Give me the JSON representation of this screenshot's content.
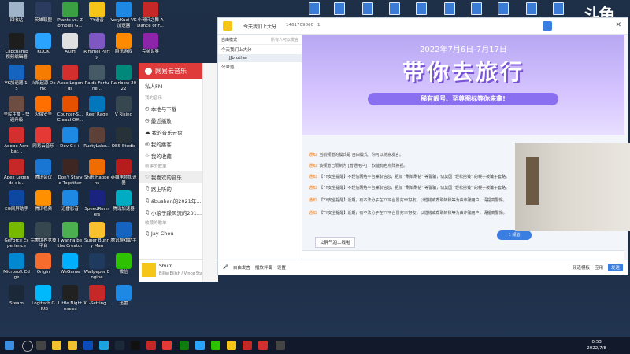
{
  "desktop_icons": [
    {
      "label": "回收站",
      "color": "#9fb4c9"
    },
    {
      "label": "英雄联盟",
      "color": "#2b3b5f"
    },
    {
      "label": "Plants vs. Zombies G...",
      "color": "#3aa043"
    },
    {
      "label": "YY语音",
      "color": "#f5c518"
    },
    {
      "label": "VeryKuai VK 加速器",
      "color": "#1e88e5"
    },
    {
      "label": "小哥只之舞 A Dance of F...",
      "color": "#c62828"
    },
    {
      "label": "Clipchamp 视频编辑器",
      "color": "#1d1d1d"
    },
    {
      "label": "KOOK",
      "color": "#2aa3ff"
    },
    {
      "label": "ALTH",
      "color": "#e0e0e0"
    },
    {
      "label": "Rimmel Party",
      "color": "#7e57c2"
    },
    {
      "label": "腾讯游戏",
      "color": "#ff8a00"
    },
    {
      "label": "完美世界",
      "color": "#8e24aa"
    },
    {
      "label": "VK加速器 1.5",
      "color": "#1565c0"
    },
    {
      "label": "火焰起源 Demo",
      "color": "#f57c00"
    },
    {
      "label": "Apex Legends",
      "color": "#d32f2f"
    },
    {
      "label": "Raids Fortune...",
      "color": "#455a64"
    },
    {
      "label": "Rainbow 2022",
      "color": "#00897b"
    },
    {
      "label": "全民主播 - 快速升级",
      "color": "#6d4c41"
    },
    {
      "label": "火绒安全",
      "color": "#ff6f00"
    },
    {
      "label": "Counter-S... Global Off...",
      "color": "#e65100"
    },
    {
      "label": "Reef Rage",
      "color": "#0277bd"
    },
    {
      "label": "V Rising",
      "color": "#37474f"
    },
    {
      "label": "Adobe Acrobat...",
      "color": "#d32f2f"
    },
    {
      "label": "网易云音乐",
      "color": "#e53935"
    },
    {
      "label": "Dev-C++",
      "color": "#1e88e5"
    },
    {
      "label": "RustyLake...",
      "color": "#5d4037"
    },
    {
      "label": "OBS Studio",
      "color": "#263238"
    },
    {
      "label": "Apex Legends dir...",
      "color": "#c62828"
    },
    {
      "label": "腾讯会议",
      "color": "#1976d2"
    },
    {
      "label": "Don't Starve Together",
      "color": "#3e2723"
    },
    {
      "label": "Shift Happens",
      "color": "#ef6c00"
    },
    {
      "label": "英雄电竞加速器",
      "color": "#b71c1c"
    },
    {
      "label": "EG同屏助手",
      "color": "#0d47a1"
    },
    {
      "label": "腾讯视频",
      "color": "#ff9100"
    },
    {
      "label": "迅雷影音",
      "color": "#1e88e5"
    },
    {
      "label": "SpeedRunners",
      "color": "#1a237e"
    },
    {
      "label": "腾讯加速器",
      "color": "#00acc1"
    },
    {
      "label": "GeForce Experience",
      "color": "#76b900"
    },
    {
      "label": "完美世界竞技平台",
      "color": "#37474f"
    },
    {
      "label": "I wanna be the Creator",
      "color": "#4caf50"
    },
    {
      "label": "Super Bunny Man",
      "color": "#fbc02d"
    },
    {
      "label": "腾讯游戏助手",
      "color": "#1565c0"
    },
    {
      "label": "Microsoft Edge",
      "color": "#0288d1"
    },
    {
      "label": "Origin",
      "color": "#f56c2d"
    },
    {
      "label": "WeGame",
      "color": "#00b0ff"
    },
    {
      "label": "Wallpaper Engine",
      "color": "#1e3a5f"
    },
    {
      "label": "微信",
      "color": "#2dc100"
    },
    {
      "label": "Steam",
      "color": "#1b2838"
    },
    {
      "label": "Logitech G HUB",
      "color": "#00b8fc"
    },
    {
      "label": "Little Nightmares",
      "color": "#212121"
    },
    {
      "label": "XL-Setting...",
      "color": "#c62828"
    },
    {
      "label": "迅雷",
      "color": "#1e88e5"
    }
  ],
  "netease": {
    "app_name": "网易云音乐",
    "private_fm": "私人FM",
    "my_music_section": "我的音乐",
    "my_items": [
      "本地与下载",
      "最近播放",
      "我的音乐云盘",
      "我的播客",
      "我的收藏"
    ],
    "created_section": "创建的歌单",
    "playlists": [
      "我喜欢的音乐",
      "路上听的",
      "ábushan的2021年...",
      "小狼子躁风流的201...",
      "Jay Chou"
    ],
    "collected_section": "收藏的歌单",
    "now_playing": {
      "title": "Sburn",
      "artist": "Billie Eilish / Vince Staples"
    }
  },
  "yy": {
    "channel_title": "今天我们上大分",
    "channel_id": "1461709860",
    "channel_count": "1",
    "left_tab_active": "自由模式",
    "left_tab_2": "所有人可以发言",
    "channel_tree": [
      "今天我们上大分",
      "JJbrother",
      "公众氪"
    ],
    "banner_date": "2022年7月6日-7月17日",
    "banner_title": "带你去旅行",
    "banner_subtitle": "稀有靓号、至尊图标等你来拿!",
    "messages": [
      {
        "tag": "通知:",
        "text": "当前频道的模式是 自由模式，你可以随意发言。"
      },
      {
        "tag": "通知:",
        "text": "该频道已限制为 [普通用户] ，仅能有色点阵换视。"
      },
      {
        "tag": "通知:",
        "text": "【YY安全提醒】不轻信网络平台兼职信息，拒加 \"刷单刷钻\" 等警骗，切莫因 \"轻松捞钱\" 的幌子被骗子套路。"
      },
      {
        "tag": "通知:",
        "text": "【YY安全提醒】不轻信网络平台兼职信息，拒加 \"刷单刷钻\" 等警骗，切莫因 \"轻松捞钱\" 的幌子被骗子套路。"
      },
      {
        "tag": "通知:",
        "text": "【YY安全提醒】近期，有不法分子在YY平台冒充YY好友，以借钱或帮助转账等为由诈骗用户，请提高警惕。"
      },
      {
        "tag": "通知:",
        "text": "【YY安全提醒】近期，有不法分子在YY平台冒充YY好友，以借钱或帮助转账等为由诈骗用户，请提高警惕。"
      }
    ],
    "notice_popup": "公屏气泡上线啦",
    "voice_mode": "自由发言",
    "record_label": "播放伴奏",
    "settings_label": "设置",
    "send_label": "发送",
    "right_btn_1": "频道模板",
    "right_btn_2": "应用",
    "right_btn_3": "1 频道",
    "accent_color": "#3b7ee1"
  },
  "streaming_logo": "斗鱼",
  "clock": {
    "time": "0:53",
    "date": "2022/7/8"
  }
}
